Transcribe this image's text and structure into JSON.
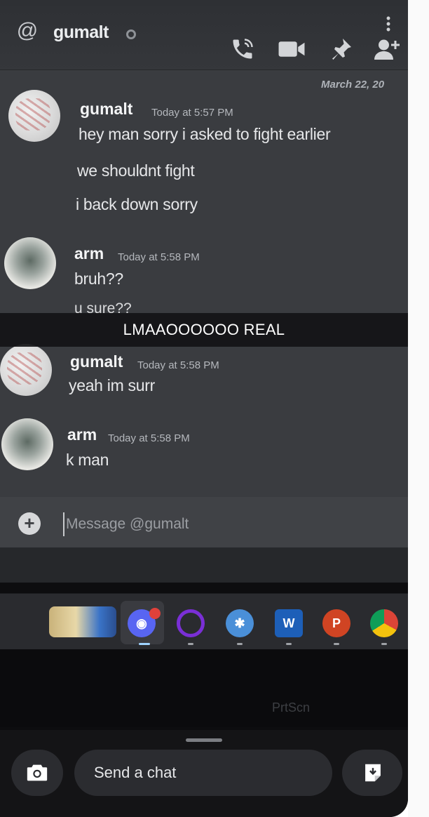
{
  "header": {
    "dm_name": "gumalt",
    "date_divider": "March 22, 20"
  },
  "messages": [
    {
      "author": "gumalt",
      "timestamp": "Today at 5:57 PM",
      "lines": [
        "hey man sorry i asked to fight earlier",
        "we shouldnt fight",
        "i back down sorry"
      ]
    },
    {
      "author": "arm",
      "timestamp": "Today at 5:58 PM",
      "lines": [
        "bruh??"
      ],
      "partial_line": "u sure??"
    },
    {
      "author": "gumalt",
      "timestamp": "Today at 5:58 PM",
      "lines": [
        "yeah im surr"
      ]
    },
    {
      "author": "arm",
      "timestamp": "Today at 5:58 PM",
      "lines": [
        "k man"
      ]
    }
  ],
  "snap_caption": "LMAAOOOOOO REAL",
  "message_bar": {
    "placeholder": "Message @gumalt"
  },
  "keyboard": {
    "visible_key": "PrtScn"
  },
  "snap_bar": {
    "chat_placeholder": "Send a chat"
  },
  "icons": [
    "at-icon",
    "call-icon",
    "video-icon",
    "pin-icon",
    "add-friend-icon",
    "more-icon",
    "plus-icon",
    "camera-icon",
    "sticker-icon"
  ],
  "colors": {
    "chat_bg": "#3a3c40",
    "header_bg": "#35373b",
    "caption_bg": "#141416",
    "badge_red": "#e0413b"
  }
}
